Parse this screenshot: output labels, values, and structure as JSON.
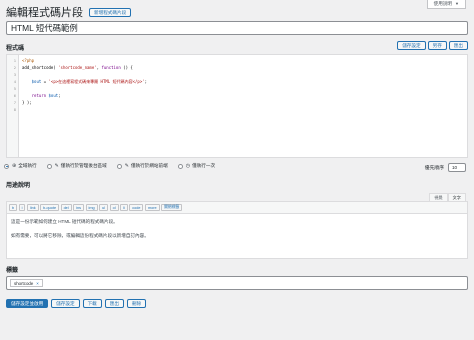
{
  "help_tab": {
    "label": "使用說明"
  },
  "header": {
    "title": "編輯程式碼片段",
    "add_new_label": "新增程式碼片段"
  },
  "snippet": {
    "title_value": "HTML 短代碼範例"
  },
  "code_section": {
    "label": "程式碼",
    "actions": [
      "儲存設定",
      "另存",
      "匯出"
    ],
    "line_numbers": [
      "1",
      "2",
      "3",
      "4",
      "5",
      "6",
      "7",
      "8"
    ],
    "lines": [
      {
        "parts": [
          {
            "t": "<?php",
            "c": "cm"
          }
        ]
      },
      {
        "parts": [
          {
            "t": "add_shortcode( ",
            "c": ""
          },
          {
            "t": "'shortcode_name'",
            "c": "str"
          },
          {
            "t": ", ",
            "c": ""
          },
          {
            "t": "function",
            "c": "kw"
          },
          {
            "t": " () {",
            "c": ""
          }
        ]
      },
      {
        "parts": [
          {
            "t": "",
            "c": ""
          }
        ]
      },
      {
        "parts": [
          {
            "t": "    ",
            "c": ""
          },
          {
            "t": "$out",
            "c": "var"
          },
          {
            "t": " = ",
            "c": ""
          },
          {
            "t": "'<p>在這裡寫程式碼來專屬 HTML 短代碼內容</p>'",
            "c": "str"
          },
          {
            "t": ";",
            "c": ""
          }
        ]
      },
      {
        "parts": [
          {
            "t": "",
            "c": ""
          }
        ]
      },
      {
        "parts": [
          {
            "t": "    ",
            "c": ""
          },
          {
            "t": "return",
            "c": "kw"
          },
          {
            "t": " ",
            "c": ""
          },
          {
            "t": "$out",
            "c": "var"
          },
          {
            "t": ";",
            "c": ""
          }
        ]
      },
      {
        "parts": [
          {
            "t": "} );",
            "c": ""
          }
        ]
      },
      {
        "parts": [
          {
            "t": "",
            "c": ""
          }
        ]
      }
    ]
  },
  "scope": {
    "options": [
      {
        "label": "全域執行",
        "icon": "globe-icon",
        "checked": true
      },
      {
        "label": "僅執行於管理後台區域",
        "icon": "wrench-icon",
        "checked": false
      },
      {
        "label": "僅執行於網站前端",
        "icon": "wrench-icon",
        "checked": false
      },
      {
        "label": "僅執行一次",
        "icon": "clock-icon",
        "checked": false
      }
    ],
    "priority_label": "優先順序",
    "priority_value": "10"
  },
  "description": {
    "label": "用途說明",
    "mode_tabs": [
      "視覺",
      "文字"
    ],
    "quicktags": [
      "b",
      "i",
      "link",
      "b-quote",
      "del",
      "ins",
      "img",
      "ul",
      "ol",
      "li",
      "code",
      "more",
      "關閉標籤"
    ],
    "paragraphs": [
      "這是一份示範如何建立 HTML 短代碼的程式碼片段。",
      "如有需要，可以將它移除，或編輯這份程式碼片段以新增自訂內容。"
    ]
  },
  "tags": {
    "label": "標籤",
    "items": [
      "shortcode"
    ]
  },
  "footer_buttons": [
    "儲存設定並啟用",
    "儲存設定",
    "下載",
    "匯出",
    "刪除"
  ],
  "colors": {
    "accent": "#2271b1",
    "background": "#f0f0f1"
  }
}
